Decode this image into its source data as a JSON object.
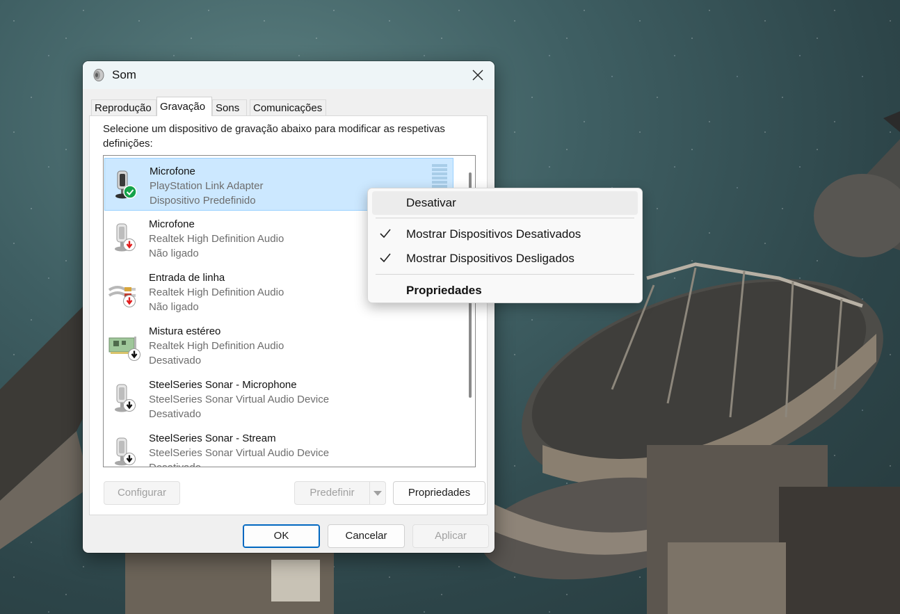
{
  "window": {
    "title": "Som"
  },
  "tabs": [
    {
      "label": "Reprodução"
    },
    {
      "label": "Gravação"
    },
    {
      "label": "Sons"
    },
    {
      "label": "Comunicações"
    }
  ],
  "panel": {
    "description": "Selecione um dispositivo de gravação abaixo para modificar as respetivas definições:"
  },
  "devices": [
    {
      "name": "Microfone",
      "driver": "PlayStation Link Adapter",
      "status": "Dispositivo Predefinido",
      "icon": "microphone-icon",
      "badge": "default-check-badge",
      "selected": true
    },
    {
      "name": "Microfone",
      "driver": "Realtek High Definition Audio",
      "status": "Não ligado",
      "icon": "microphone-icon",
      "badge": "unplugged-badge"
    },
    {
      "name": "Entrada de linha",
      "driver": "Realtek High Definition Audio",
      "status": "Não ligado",
      "icon": "line-in-cable-icon",
      "badge": "unplugged-badge"
    },
    {
      "name": "Mistura estéreo",
      "driver": "Realtek High Definition Audio",
      "status": "Desativado",
      "icon": "sound-card-icon",
      "badge": "disabled-badge"
    },
    {
      "name": "SteelSeries Sonar - Microphone",
      "driver": "SteelSeries Sonar Virtual Audio Device",
      "status": "Desativado",
      "icon": "microphone-icon",
      "badge": "disabled-badge"
    },
    {
      "name": "SteelSeries Sonar - Stream",
      "driver": "SteelSeries Sonar Virtual Audio Device",
      "status": "Desativado",
      "icon": "microphone-icon",
      "badge": "disabled-badge"
    }
  ],
  "buttons": {
    "configure": "Configurar",
    "set_default": "Predefinir",
    "properties": "Propriedades",
    "ok": "OK",
    "cancel": "Cancelar",
    "apply": "Aplicar"
  },
  "context_menu": {
    "items": [
      {
        "label": "Desativar"
      },
      {
        "label": "Mostrar Dispositivos Desativados",
        "checked": true
      },
      {
        "label": "Mostrar Dispositivos Desligados",
        "checked": true
      },
      {
        "label": "Propriedades"
      }
    ]
  },
  "colors": {
    "selection": "#cce8ff",
    "accent": "#0067c0",
    "default_badge": "#16a34a",
    "unplugged_badge": "#e11d1d"
  }
}
